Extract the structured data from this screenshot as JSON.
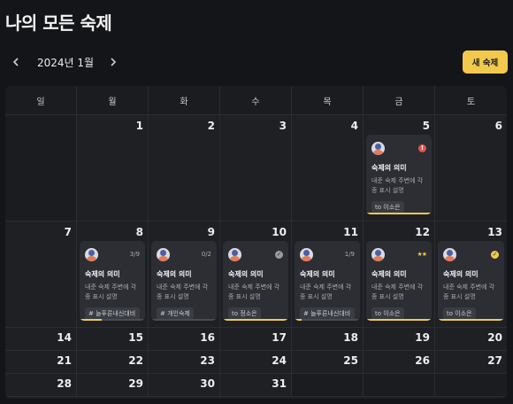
{
  "page": {
    "title": "나의 모든 숙제"
  },
  "nav": {
    "month": "2024년 1월",
    "prev_icon": "chevron-left-icon",
    "next_icon": "chevron-right-icon"
  },
  "actions": {
    "new_label": "새 숙제"
  },
  "weekdays": [
    "일",
    "월",
    "화",
    "수",
    "목",
    "금",
    "토"
  ],
  "colors": {
    "accent": "#f2c94c",
    "alert": "#e0544b",
    "background": "#141518",
    "card": "#2c2e34"
  },
  "weeks": [
    {
      "days": [
        "",
        "1",
        "2",
        "3",
        "4",
        "5",
        "6"
      ]
    },
    {
      "days": [
        "7",
        "8",
        "9",
        "10",
        "11",
        "12",
        "13"
      ]
    },
    {
      "days": [
        "14",
        "15",
        "16",
        "17",
        "18",
        "19",
        "20"
      ]
    },
    {
      "days": [
        "21",
        "22",
        "23",
        "24",
        "25",
        "26",
        "27"
      ]
    },
    {
      "days": [
        "28",
        "29",
        "30",
        "31",
        "",
        "",
        ""
      ]
    }
  ],
  "cards": {
    "d5": {
      "title": "숙제의 의미",
      "desc": "내준 숙제 주변에 각종 표시 설명",
      "tag": "to 이소은",
      "status": "alert",
      "progress": 1.0
    },
    "d8": {
      "title": "숙제의 의미",
      "desc": "내준 숙제 주변에 각종 표시 설명",
      "tag": "# 늘푸른내신대비반",
      "count": "3/9",
      "progress": 0.333
    },
    "d9": {
      "title": "숙제의 의미",
      "desc": "내준 숙제 주변에 각종 표시 설명",
      "tag": "# 개인숙제",
      "count": "0/2",
      "progress": 0.0
    },
    "d10": {
      "title": "숙제의 의미",
      "desc": "내준 숙제 주변에 각종 표시 설명",
      "tag": "to 정소은",
      "status": "done-gray",
      "progress": 1.0
    },
    "d11": {
      "title": "숙제의 의미",
      "desc": "내준 숙제 주변에 각종 표시 설명",
      "tag": "# 늘푸른내신대비반",
      "count": "1/9",
      "progress": 0.111
    },
    "d12": {
      "title": "숙제의 의미",
      "desc": "내준 숙제 주변에 각종 표시 설명",
      "tag": "to 이소은",
      "stars": "★★",
      "progress": 1.0
    },
    "d13": {
      "title": "숙제의 의미",
      "desc": "내준 숙제 주변에 각종 표시 설명",
      "tag": "to 이소은",
      "status": "done-yellow",
      "progress": 1.0
    }
  }
}
